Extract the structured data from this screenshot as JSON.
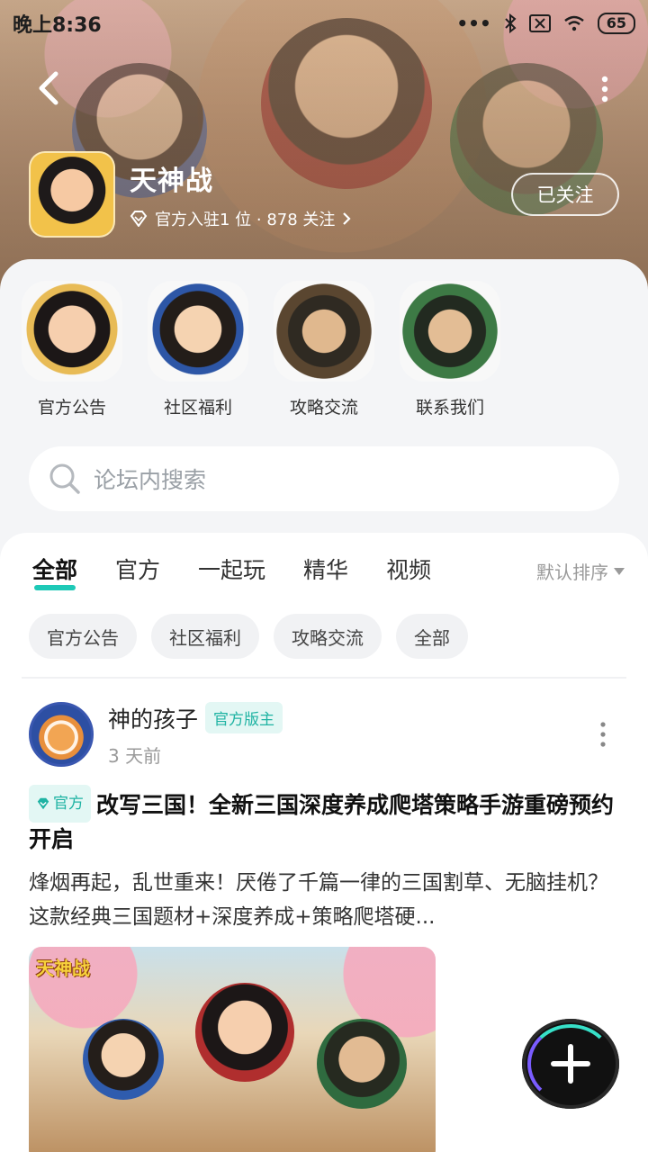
{
  "status_bar": {
    "time": "晚上8:36",
    "signal_text": "•••",
    "battery": "65"
  },
  "header": {
    "game_name": "天神战",
    "meta": "官方入驻1 位 · 878 关注",
    "follow_label": "已关注"
  },
  "quick_links": [
    {
      "label": "官方公告"
    },
    {
      "label": "社区福利"
    },
    {
      "label": "攻略交流"
    },
    {
      "label": "联系我们"
    }
  ],
  "search": {
    "placeholder": "论坛内搜索"
  },
  "tabs": [
    {
      "label": "全部",
      "active": true
    },
    {
      "label": "官方"
    },
    {
      "label": "一起玩"
    },
    {
      "label": "精华"
    },
    {
      "label": "视频"
    }
  ],
  "sort": {
    "label": "默认排序"
  },
  "chips": [
    {
      "label": "官方公告"
    },
    {
      "label": "社区福利"
    },
    {
      "label": "攻略交流"
    },
    {
      "label": "全部"
    }
  ],
  "post": {
    "author": "神的孩子",
    "role": "官方版主",
    "time": "3 天前",
    "badge": "官方",
    "title": "改写三国！全新三国深度养成爬塔策略手游重磅预约开启",
    "body": "烽烟再起，乱世重来！厌倦了千篇一律的三国割草、无脑挂机？这款经典三国题材+深度养成+策略爬塔硬...",
    "image_logo": "天神战"
  },
  "colors": {
    "accent": "#1ec9b7",
    "badge_bg": "#e3f7f4"
  }
}
